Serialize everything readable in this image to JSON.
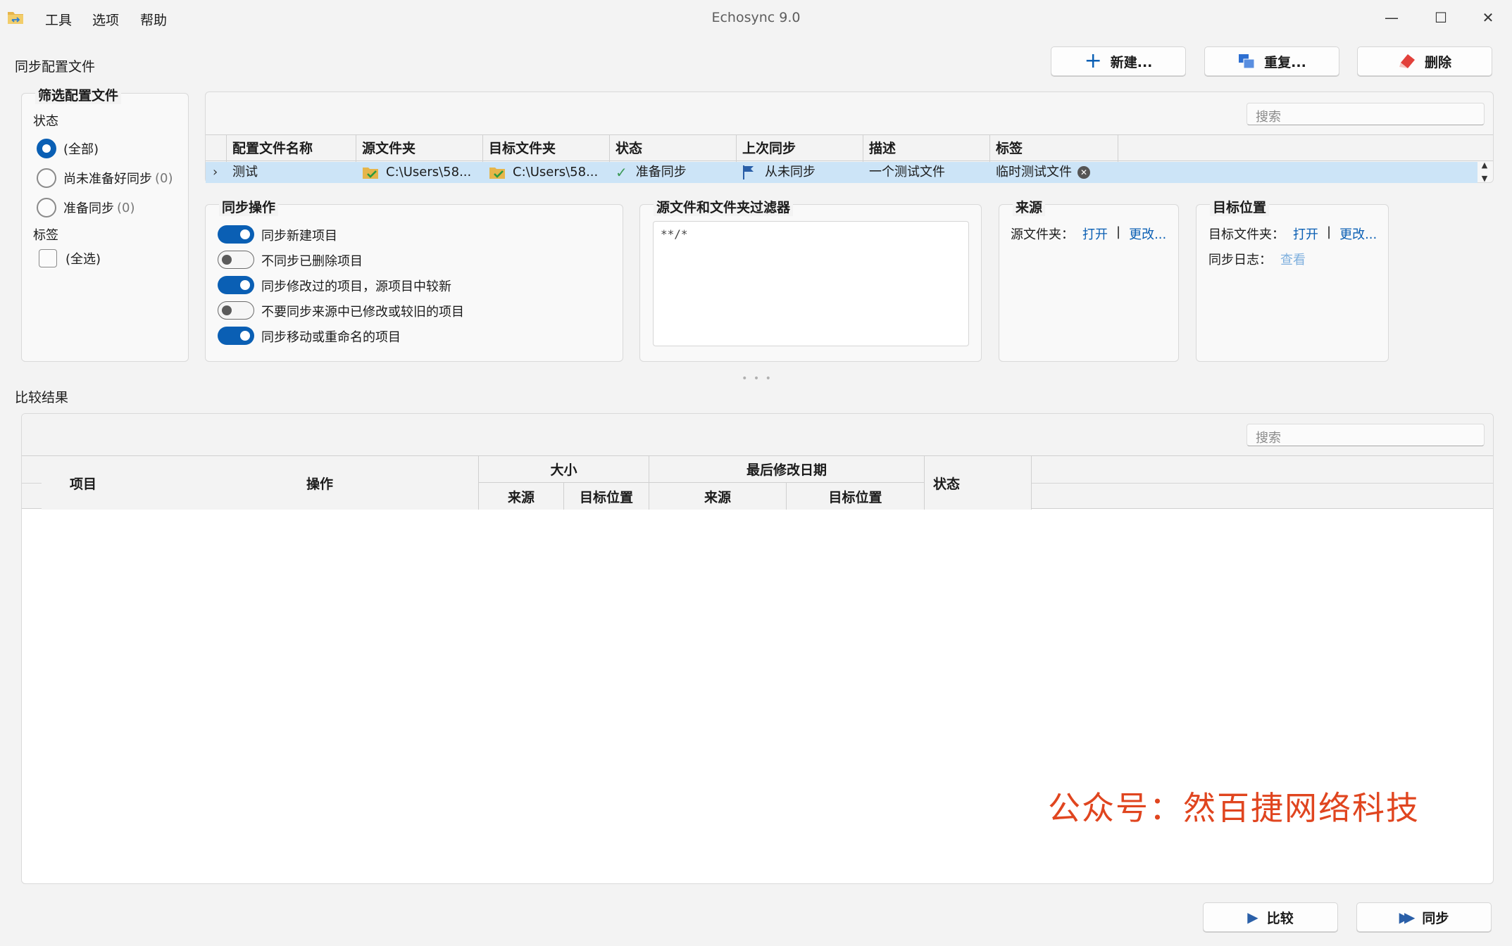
{
  "window": {
    "title": "Echosync 9.0",
    "menu": [
      "工具",
      "选项",
      "帮助"
    ],
    "controls": {
      "minimize": "—",
      "maximize": "☐",
      "close": "✕"
    }
  },
  "profiles_section": {
    "title": "同步配置文件",
    "buttons": {
      "new": "新建...",
      "duplicate": "重复...",
      "delete": "删除"
    },
    "search_placeholder": "搜索"
  },
  "filter": {
    "title": "筛选配置文件",
    "status_label": "状态",
    "status_options": [
      {
        "label": "(全部)",
        "count": "",
        "selected": true
      },
      {
        "label": "尚未准备好同步",
        "count": "(0)",
        "selected": false
      },
      {
        "label": "准备同步",
        "count": "(0)",
        "selected": false
      }
    ],
    "tags_label": "标签",
    "tags_select_all": "(全选)"
  },
  "profile_table": {
    "columns": [
      "配置文件名称",
      "源文件夹",
      "目标文件夹",
      "状态",
      "上次同步",
      "描述",
      "标签"
    ],
    "rows": [
      {
        "name": "测试",
        "source": "C:\\Users\\58...",
        "target": "C:\\Users\\58...",
        "status": "准备同步",
        "last_sync": "从未同步",
        "description": "一个测试文件",
        "tag": "临时测试文件"
      }
    ]
  },
  "sync_ops": {
    "title": "同步操作",
    "options": [
      {
        "label": "同步新建项目",
        "on": true
      },
      {
        "label": "不同步已删除项目",
        "on": false
      },
      {
        "label": "同步修改过的项目，源项目中较新",
        "on": true
      },
      {
        "label": "不要同步来源中已修改或较旧的项目",
        "on": false
      },
      {
        "label": "同步移动或重命名的项目",
        "on": true
      }
    ]
  },
  "filters_box": {
    "title": "源文件和文件夹过滤器",
    "value": "**/*"
  },
  "source_box": {
    "title": "来源",
    "folder_label": "源文件夹：",
    "open": "打开",
    "separator": "|",
    "change": "更改..."
  },
  "target_box": {
    "title": "目标位置",
    "folder_label": "目标文件夹：",
    "open": "打开",
    "separator": "|",
    "change": "更改...",
    "log_label": "同步日志：",
    "log_view": "查看"
  },
  "splitter": "• • •",
  "results": {
    "title": "比较结果",
    "search_placeholder": "搜索",
    "headers": {
      "item": "项目",
      "action": "操作",
      "size": "大小",
      "size_source": "来源",
      "size_target": "目标位置",
      "modified": "最后修改日期",
      "modified_source": "来源",
      "modified_target": "目标位置",
      "status": "状态"
    }
  },
  "bottom_buttons": {
    "compare": "比较",
    "sync": "同步"
  },
  "watermark": "公众号：然百捷网络科技",
  "colors": {
    "accent": "#0a5fb4",
    "selected_row": "#cce4f7",
    "watermark": "#e0451f"
  }
}
